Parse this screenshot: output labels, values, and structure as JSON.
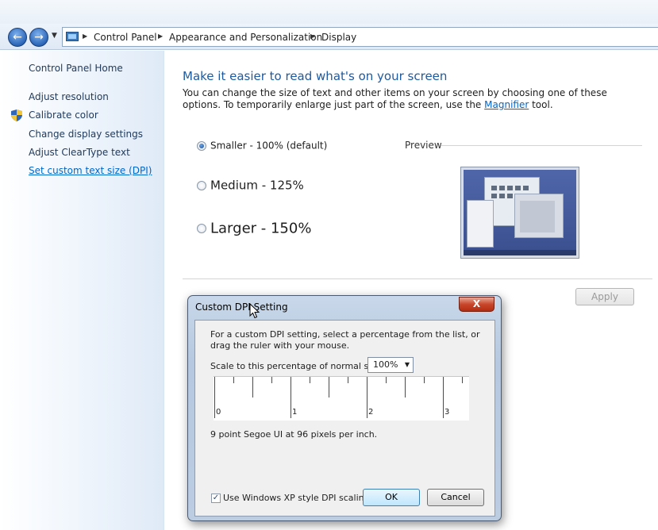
{
  "address_bar": {
    "crumbs": [
      "Control Panel",
      "Appearance and Personalization",
      "Display"
    ]
  },
  "sidebar": {
    "items": [
      {
        "label": "Control Panel Home"
      },
      {
        "label": "Adjust resolution"
      },
      {
        "label": "Calibrate color"
      },
      {
        "label": "Change display settings"
      },
      {
        "label": "Adjust ClearType text"
      },
      {
        "label": "Set custom text size (DPI)"
      }
    ]
  },
  "main": {
    "title": "Make it easier to read what's on your screen",
    "description_before": "You can change the size of text and other items on your screen by choosing one of these options. To temporarily enlarge just part of the screen, use the ",
    "description_link": "Magnifier",
    "description_after": " tool.",
    "options": [
      {
        "label": "Smaller - 100% (default)",
        "selected": true
      },
      {
        "label": "Medium - 125%",
        "selected": false
      },
      {
        "label": "Larger - 150%",
        "selected": false
      }
    ],
    "preview_label": "Preview",
    "apply_label": "Apply"
  },
  "dialog": {
    "title": "Custom DPI Setting",
    "close_label": "X",
    "instructions": "For a custom DPI setting, select a percentage from the list, or drag the ruler with your mouse.",
    "scale_label": "Scale to this percentage of normal size:",
    "scale_value": "100%",
    "ruler_labels": [
      "0",
      "1",
      "2",
      "3"
    ],
    "font_info": "9 point Segoe UI at 96 pixels per inch.",
    "xp_scaling_label": "Use Windows XP style DPI scaling",
    "xp_scaling_checked": true,
    "ok_label": "OK",
    "cancel_label": "Cancel"
  }
}
